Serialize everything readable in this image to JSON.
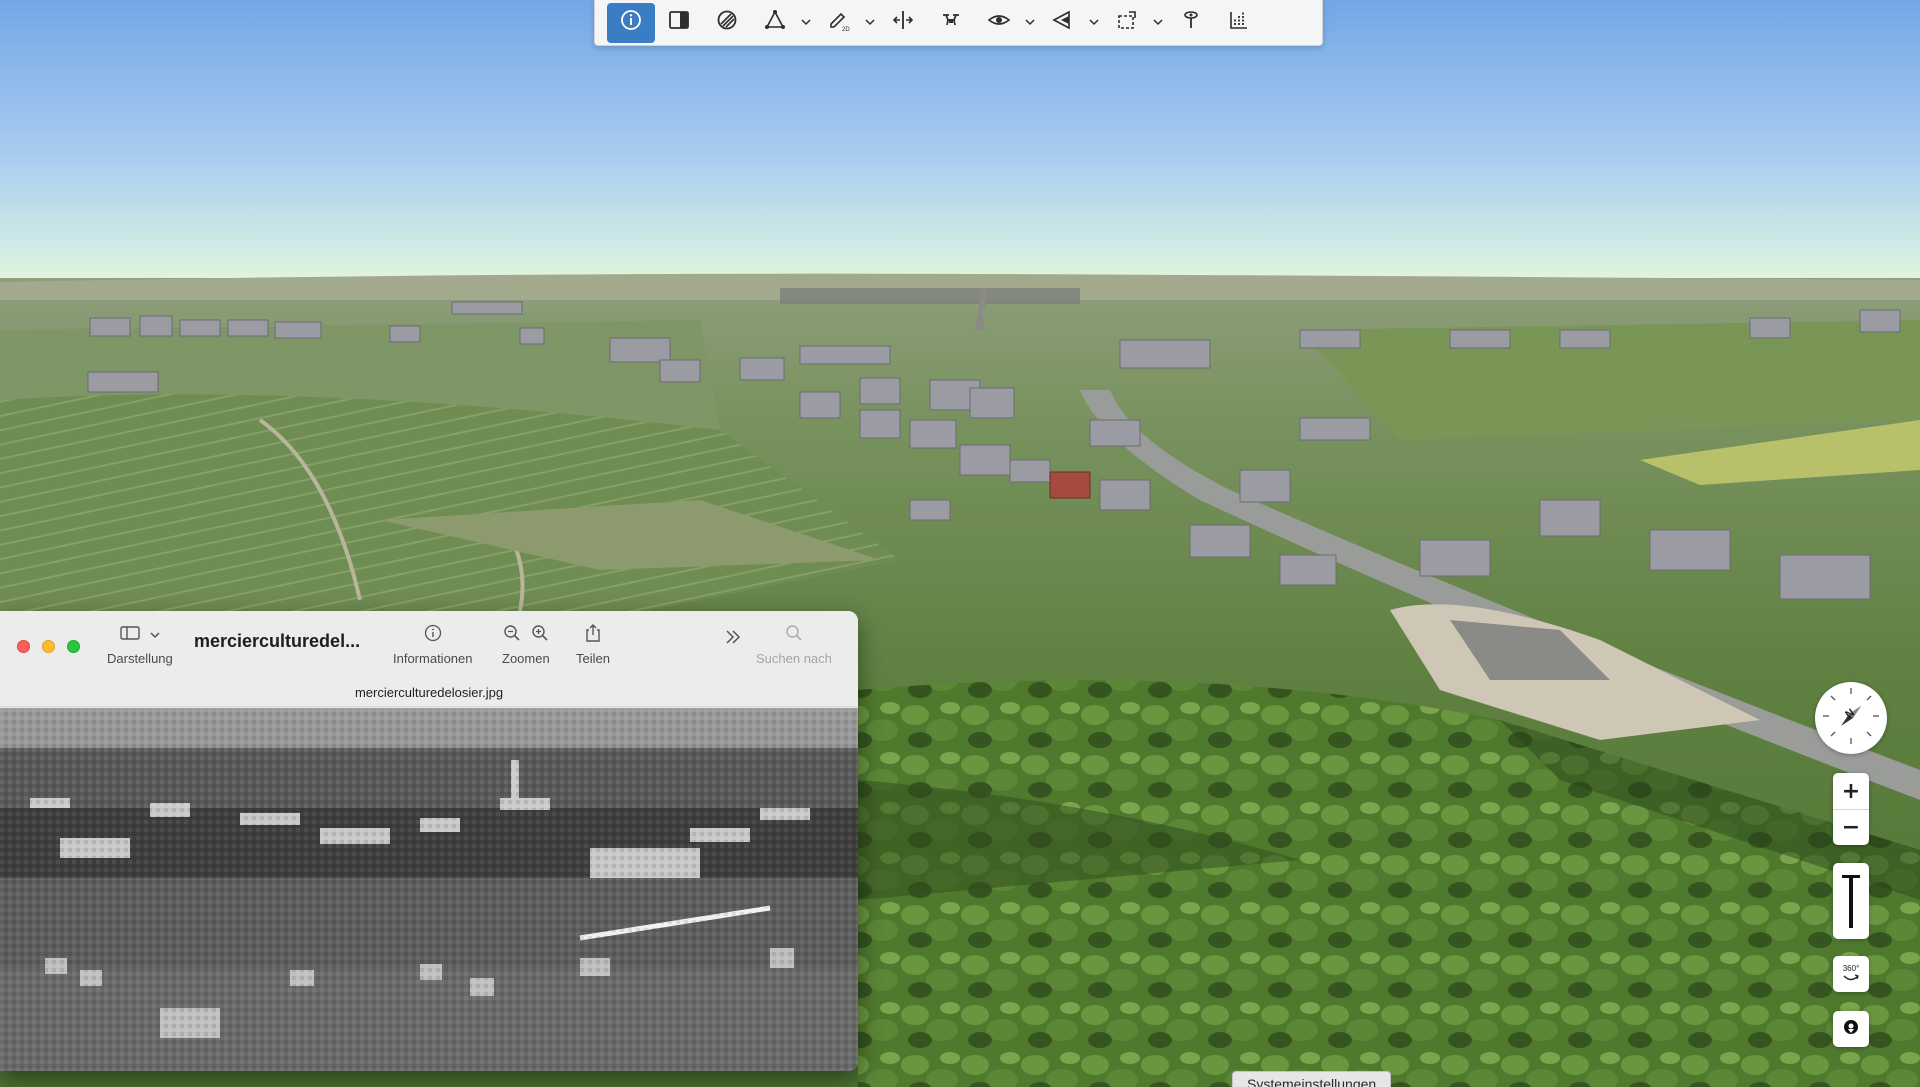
{
  "toolbar": {
    "buttons": [
      {
        "name": "info-icon",
        "active": true
      },
      {
        "name": "sidebar-panel-icon"
      },
      {
        "name": "terrain-shading-icon"
      },
      {
        "name": "polygon-measure-icon",
        "dropdown": true
      },
      {
        "name": "draw-2d-icon",
        "dropdown": true,
        "sub_label": "2D"
      },
      {
        "name": "split-view-icon"
      },
      {
        "name": "drone-icon"
      },
      {
        "name": "visibility-eye-icon",
        "dropdown": true
      },
      {
        "name": "shadow-projection-icon",
        "dropdown": true
      },
      {
        "name": "area-select-icon",
        "dropdown": true
      },
      {
        "name": "pin-probe-icon"
      },
      {
        "name": "profile-chart-icon"
      }
    ]
  },
  "map_controls": {
    "compass_label": "N",
    "zoom_in": "+",
    "zoom_out": "−",
    "rotate_label": "360°"
  },
  "preview_window": {
    "title": "merciercul­turedel...",
    "filename": "mercierculturedelosier.jpg",
    "tools": {
      "view": "Darstellung",
      "info": "Informationen",
      "zoom": "Zoomen",
      "share": "Teilen",
      "search": "Suchen nach"
    }
  },
  "tooltip": {
    "text": "Systemeinstellungen"
  },
  "colors": {
    "accent": "#3b7dc4",
    "sky_top": "#7eaee8",
    "sky_horizon": "#dff3d6",
    "field_green": "#6a8a4a"
  }
}
